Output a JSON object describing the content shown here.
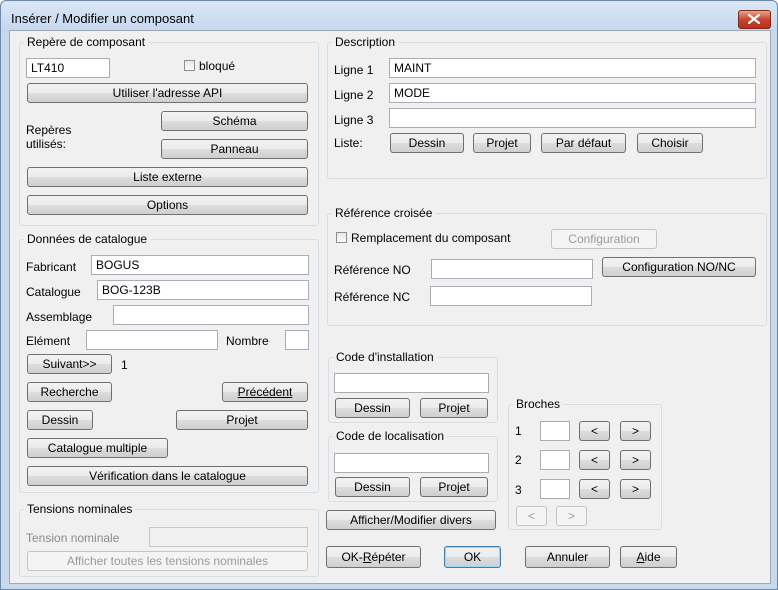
{
  "window": {
    "title": "Insérer / Modifier un composant"
  },
  "repere": {
    "legend": "Repère de composant",
    "tag_value": "LT410",
    "bloque_label": "bloqué",
    "api_button": "Utiliser l'adresse API",
    "reperes_label_1": "Repères",
    "reperes_label_2": "utilisés:",
    "schema_button": "Schéma",
    "panneau_button": "Panneau",
    "liste_externe_button": "Liste externe",
    "options_button": "Options"
  },
  "catalogue": {
    "legend": "Données de catalogue",
    "fabricant_label": "Fabricant",
    "fabricant_value": "BOGUS",
    "catalogue_label": "Catalogue",
    "catalogue_value": "BOG-123B",
    "assemblage_label": "Assemblage",
    "assemblage_value": "",
    "element_label": "Elément",
    "element_value": "",
    "nombre_label": "Nombre",
    "nombre_value": "",
    "suivant_button": "Suivant>>",
    "suivant_count": "1",
    "recherche_button": "Recherche",
    "precedent_button": "Précédent",
    "dessin_button": "Dessin",
    "projet_button": "Projet",
    "multiple_button": "Catalogue multiple",
    "verification_button": "Vérification dans le catalogue"
  },
  "tensions": {
    "legend": "Tensions nominales",
    "tension_label": "Tension nominale",
    "tension_value": "",
    "afficher_button": "Afficher toutes les tensions nominales"
  },
  "description": {
    "legend": "Description",
    "ligne1_label": "Ligne 1",
    "ligne1_value": "MAINT",
    "ligne2_label": "Ligne 2",
    "ligne2_value": "MODE",
    "ligne3_label": "Ligne 3",
    "ligne3_value": "",
    "liste_label": "Liste:",
    "dessin_button": "Dessin",
    "projet_button": "Projet",
    "defaut_button": "Par défaut",
    "choisir_button": "Choisir"
  },
  "croisee": {
    "legend": "Référence croisée",
    "remplacement_label": "Remplacement du composant",
    "configuration_button": "Configuration",
    "ref_no_label": "Référence NO",
    "ref_no_value": "",
    "config_nonc_button": "Configuration NO/NC",
    "ref_nc_label": "Référence NC",
    "ref_nc_value": ""
  },
  "installation": {
    "legend": "Code d'installation",
    "value": "",
    "dessin_button": "Dessin",
    "projet_button": "Projet"
  },
  "localisation": {
    "legend": "Code de localisation",
    "value": "",
    "dessin_button": "Dessin",
    "projet_button": "Projet"
  },
  "broches": {
    "legend": "Broches",
    "rows": [
      {
        "label": "1",
        "value": ""
      },
      {
        "label": "2",
        "value": ""
      },
      {
        "label": "3",
        "value": ""
      }
    ],
    "prev_glyph": "<",
    "next_glyph": ">"
  },
  "divers_button": "Afficher/Modifier divers",
  "footer": {
    "ok_repeter_pre": "OK-",
    "ok_repeter_u": "R",
    "ok_repeter_post": "épéter",
    "ok": "OK",
    "annuler": "Annuler",
    "aide_u": "A",
    "aide_post": "ide"
  }
}
